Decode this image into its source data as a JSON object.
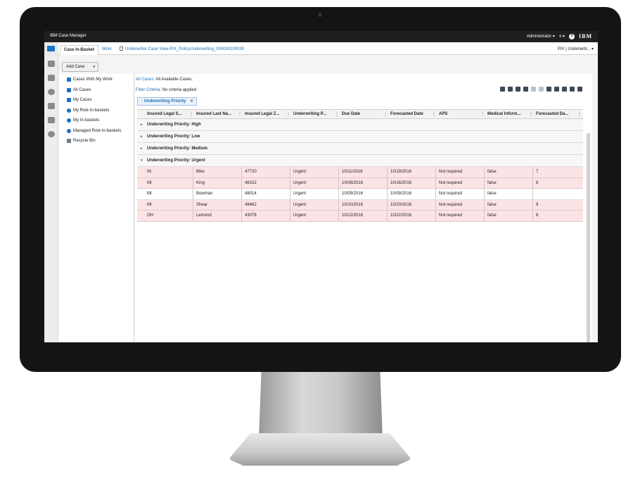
{
  "app": {
    "title": "IBM Case Manager",
    "user": "Administrator ▾",
    "menu": "≡ ▾",
    "help": "?",
    "logo": "IBM"
  },
  "tabs": [
    {
      "label": "Case In-Basket"
    },
    {
      "label": "Work"
    },
    {
      "label": "Underwriter Case View-PIX_PolicyUnderwriting_000000100030"
    }
  ],
  "tab_right": "PIX | Underwriti... ▾",
  "add_case": {
    "label": "Add Case",
    "caret": "▾"
  },
  "nav": [
    {
      "label": "Cases With My Work",
      "icon": "briefcase-icon"
    },
    {
      "label": "All Cases",
      "icon": "cases-icon"
    },
    {
      "label": "My Cases",
      "icon": "case-icon"
    },
    {
      "label": "My Role In-baskets",
      "icon": "person-icon"
    },
    {
      "label": "My In-baskets",
      "icon": "person-icon"
    },
    {
      "label": "Managed Role In-baskets",
      "icon": "people-icon"
    },
    {
      "label": "Recycle Bin",
      "icon": "trash-icon"
    }
  ],
  "info": {
    "cases_label": "All Cases:",
    "cases_value": "All Available Cases.",
    "filter_label": "Filter Criteria:",
    "filter_value": "No criteria applied"
  },
  "group_chip": {
    "label": "Underwriting Priority",
    "close": "✕",
    "arrow": "↑"
  },
  "columns": [
    "Insured Legal S...",
    "Insured Last Na...",
    "Insured Legal Z...",
    "Underwriting P...",
    "Due Date",
    "Forecasted Date",
    "APS",
    "Medical Inform...",
    "Forecasted Da..."
  ],
  "groups": [
    {
      "label": "Underwriting Priority: High",
      "tri": "▸"
    },
    {
      "label": "Underwriting Priority: Low",
      "tri": "▸"
    },
    {
      "label": "Underwriting Priority: Medium",
      "tri": "▸"
    },
    {
      "label": "Underwriting Priority: Urgent",
      "tri": "▾"
    }
  ],
  "rows": [
    {
      "c": [
        "IN",
        "Bike",
        "47720",
        "Urgent",
        "10/11/2016",
        "10/19/2016",
        "Not required",
        "false",
        "7"
      ],
      "color": "pink"
    },
    {
      "c": [
        "MI",
        "King",
        "48152",
        "Urgent",
        "10/08/2016",
        "10/16/2016",
        "Not required",
        "false",
        "6"
      ],
      "color": "pink"
    },
    {
      "c": [
        "MI",
        "Bowman",
        "48014",
        "Urgent",
        "10/09/2016",
        "10/09/2016",
        "Not required",
        "false",
        ""
      ],
      "color": "white"
    },
    {
      "c": [
        "MI",
        "Shear",
        "48462",
        "Urgent",
        "10/10/2016",
        "10/20/2016",
        "Not required",
        "false",
        "9"
      ],
      "color": "pink"
    },
    {
      "c": [
        "OH",
        "Lemond",
        "43078",
        "Urgent",
        "10/12/2016",
        "10/22/2016",
        "Not required",
        "false",
        "8"
      ],
      "color": "pink"
    }
  ]
}
